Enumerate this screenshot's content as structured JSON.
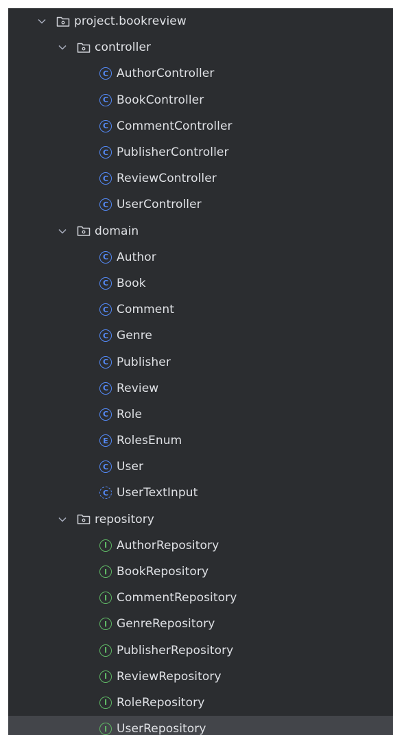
{
  "colors": {
    "panel_bg": "#2b2d30",
    "selected_bg": "#43454a",
    "text": "#dfe1e5",
    "class_icon": "#548af7",
    "interface_icon": "#5fb865",
    "chevron": "#a8adbd"
  },
  "tree": {
    "root": {
      "label": "project.bookreview",
      "icon": "package-folder-icon",
      "expanded": true
    },
    "controller": {
      "label": "controller",
      "icon": "package-folder-icon",
      "expanded": true,
      "items": [
        {
          "label": "AuthorController",
          "kind": "C",
          "icon": "class-icon"
        },
        {
          "label": "BookController",
          "kind": "C",
          "icon": "class-icon"
        },
        {
          "label": "CommentController",
          "kind": "C",
          "icon": "class-icon"
        },
        {
          "label": "PublisherController",
          "kind": "C",
          "icon": "class-icon"
        },
        {
          "label": "ReviewController",
          "kind": "C",
          "icon": "class-icon"
        },
        {
          "label": "UserController",
          "kind": "C",
          "icon": "class-icon"
        }
      ]
    },
    "domain": {
      "label": "domain",
      "icon": "package-folder-icon",
      "expanded": true,
      "items": [
        {
          "label": "Author",
          "kind": "C",
          "icon": "class-icon"
        },
        {
          "label": "Book",
          "kind": "C",
          "icon": "class-icon"
        },
        {
          "label": "Comment",
          "kind": "C",
          "icon": "class-icon"
        },
        {
          "label": "Genre",
          "kind": "C",
          "icon": "class-icon"
        },
        {
          "label": "Publisher",
          "kind": "C",
          "icon": "class-icon"
        },
        {
          "label": "Review",
          "kind": "C",
          "icon": "class-icon"
        },
        {
          "label": "Role",
          "kind": "C",
          "icon": "class-icon"
        },
        {
          "label": "RolesEnum",
          "kind": "E",
          "icon": "enum-icon"
        },
        {
          "label": "User",
          "kind": "C",
          "icon": "class-icon"
        },
        {
          "label": "UserTextInput",
          "kind": "C",
          "icon": "abstract-class-icon"
        }
      ]
    },
    "repository": {
      "label": "repository",
      "icon": "package-folder-icon",
      "expanded": true,
      "items": [
        {
          "label": "AuthorRepository",
          "kind": "I",
          "icon": "interface-icon"
        },
        {
          "label": "BookRepository",
          "kind": "I",
          "icon": "interface-icon"
        },
        {
          "label": "CommentRepository",
          "kind": "I",
          "icon": "interface-icon"
        },
        {
          "label": "GenreRepository",
          "kind": "I",
          "icon": "interface-icon"
        },
        {
          "label": "PublisherRepository",
          "kind": "I",
          "icon": "interface-icon"
        },
        {
          "label": "ReviewRepository",
          "kind": "I",
          "icon": "interface-icon"
        },
        {
          "label": "RoleRepository",
          "kind": "I",
          "icon": "interface-icon"
        },
        {
          "label": "UserRepository",
          "kind": "I",
          "icon": "interface-icon",
          "selected": true
        }
      ]
    }
  }
}
